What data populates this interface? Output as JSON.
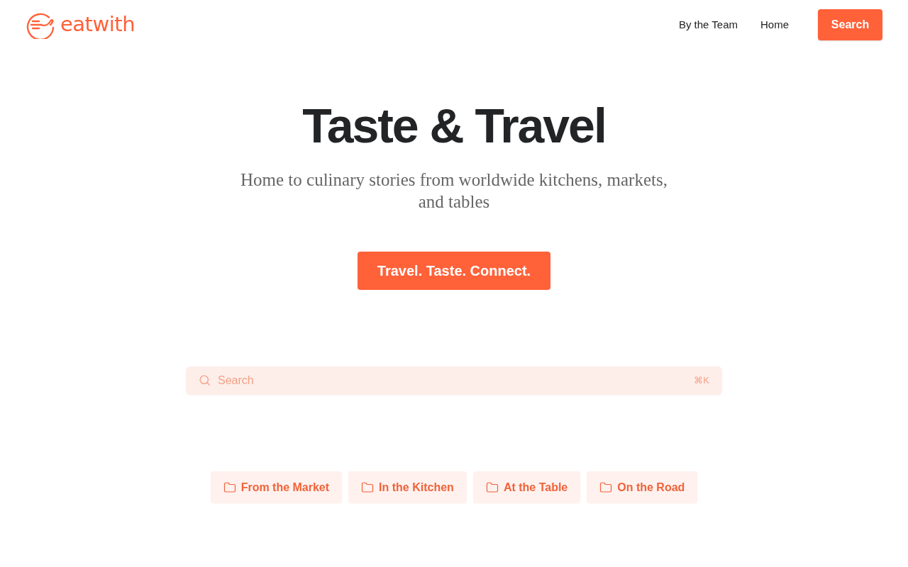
{
  "header": {
    "logo": {
      "wordmark": "eatwith"
    },
    "nav_links": [
      "By the Team",
      "Home"
    ],
    "search_button": "Search"
  },
  "hero": {
    "title": "Taste & Travel",
    "subtitle": "Home to culinary stories from worldwide kitchens, markets, and tables",
    "cta": "Travel. Taste. Connect."
  },
  "search": {
    "placeholder": "Search",
    "shortcut": "⌘K"
  },
  "categories": [
    {
      "label": "From the Market"
    },
    {
      "label": "In the Kitchen"
    },
    {
      "label": "At the Table"
    },
    {
      "label": "On the Road"
    }
  ]
}
